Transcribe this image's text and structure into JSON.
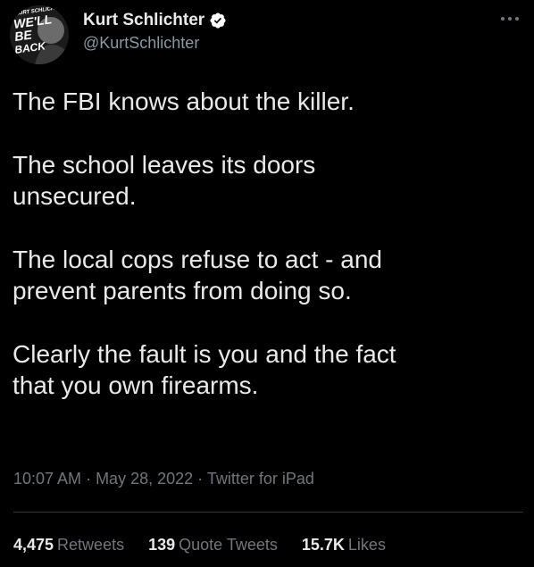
{
  "author": {
    "display_name": "Kurt Schlichter",
    "handle": "@KurtSchlichter",
    "avatar_text": {
      "line1": "KURT SCHLICHTER",
      "line2": "WE'LL",
      "line3": "BE",
      "line4": "BACK"
    },
    "verified": true
  },
  "tweet": {
    "paragraphs": [
      "The FBI knows about the killer.",
      "The school leaves its doors\nunsecured.",
      "The local cops refuse to act - and\nprevent parents from doing so.",
      "Clearly the fault is you and the fact\nthat you own firearms."
    ]
  },
  "meta": {
    "time": "10:07 AM",
    "separator": " · ",
    "date": "May 28, 2022",
    "source": "Twitter for iPad"
  },
  "stats": {
    "retweets_count": "4,475",
    "retweets_label": "Retweets",
    "quotes_count": "139",
    "quotes_label": "Quote Tweets",
    "likes_count": "15.7K",
    "likes_label": "Likes"
  },
  "colors": {
    "background": "#000000",
    "primary_text": "#e7e9ea",
    "secondary_text": "#71767b",
    "handle_text": "#8b98a5",
    "verified_badge": "#ffffff",
    "divider": "#2f3336"
  },
  "icons": {
    "verified": "verified-badge-icon",
    "more": "more-options-icon"
  }
}
